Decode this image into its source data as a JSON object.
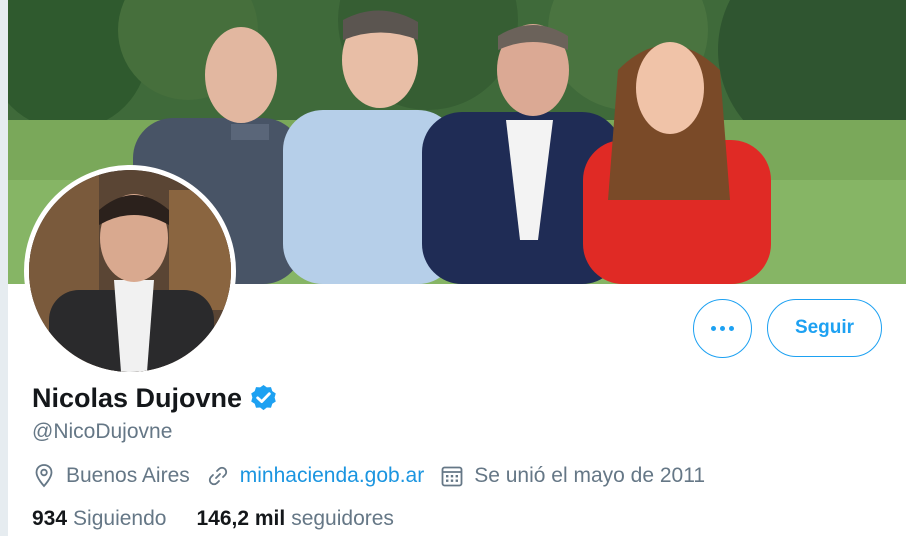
{
  "profile": {
    "display_name": "Nicolas Dujovne",
    "handle": "@NicoDujovne",
    "location": "Buenos Aires",
    "website": "minhacienda.gob.ar",
    "joined": "Se unió el mayo de 2011",
    "verified": true
  },
  "actions": {
    "follow_label": "Seguir",
    "more_label": "•••"
  },
  "stats": {
    "following_count": "934",
    "following_label": "Siguiendo",
    "followers_count": "146,2 mil",
    "followers_label": "seguidores"
  },
  "icons": {
    "location": "location-pin-icon",
    "website": "link-icon",
    "joined": "calendar-icon",
    "verified": "verified-badge-icon",
    "more": "more-dots-icon"
  },
  "colors": {
    "accent": "#1da1f2",
    "link": "#1b95e0",
    "secondary_text": "#657786",
    "primary_text": "#14171a"
  }
}
